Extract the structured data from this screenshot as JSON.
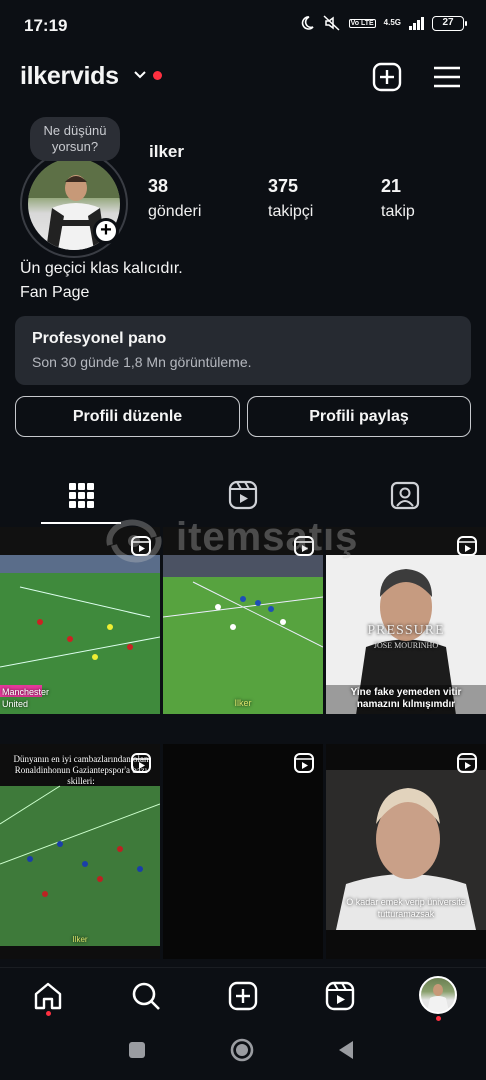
{
  "status_bar": {
    "time": "17:19",
    "network": "4.5G",
    "battery": "27"
  },
  "header": {
    "username": "ilkervids"
  },
  "profile": {
    "note": "Ne düşünü yorsun?",
    "display_name": "ilker",
    "stats": [
      {
        "count": "38",
        "label": "gönderi"
      },
      {
        "count": "375",
        "label": "takipçi"
      },
      {
        "count": "21",
        "label": "takip"
      }
    ],
    "bio_line1": "Ün geçici klas kalıcıdır.",
    "bio_line2": "Fan Page"
  },
  "dashboard": {
    "title": "Profesyonel pano",
    "subtitle": "Son 30 günde 1,8 Mn görüntüleme."
  },
  "buttons": {
    "edit": "Profili düzenle",
    "share": "Profili paylaş"
  },
  "watermark": "itemsatış",
  "posts": {
    "p1_caption": "Manchester United",
    "p4_caption": "Yine fake yemeden vitir namazını kılmışımdır",
    "p4_title": "PRESSURE",
    "p4_sub": "JOSE MOURINHO",
    "p5_caption": "Dünyanın en iyi cambazlarından olan Ronaldinhonun Gaziantepspor'a bazı skilleri:",
    "p7_caption": "O kadar emek verip üniversite tutturamazsak",
    "p2_label": "Ilker",
    "p5_label": "Ilker"
  },
  "colors": {
    "accent_red": "#ff3040",
    "background": "#0c0f14",
    "card": "#262a31"
  }
}
